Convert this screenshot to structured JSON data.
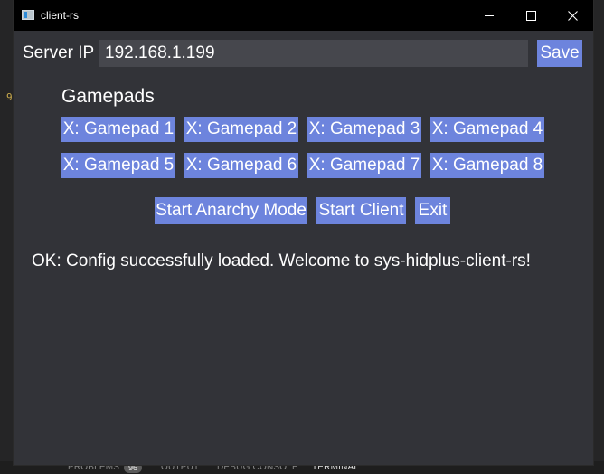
{
  "window": {
    "title": "client-rs"
  },
  "server": {
    "label": "Server IP",
    "ip_value": "192.168.1.199",
    "save_label": "Save"
  },
  "gamepads": {
    "heading": "Gamepads",
    "buttons": [
      "X: Gamepad 1",
      "X: Gamepad 2",
      "X: Gamepad 3",
      "X: Gamepad 4",
      "X: Gamepad 5",
      "X: Gamepad 6",
      "X: Gamepad 7",
      "X: Gamepad 8"
    ]
  },
  "actions": {
    "anarchy_label": "Start Anarchy Mode",
    "start_client_label": "Start Client",
    "exit_label": "Exit"
  },
  "status": {
    "message": "OK: Config successfully loaded. Welcome to sys-hidplus-client-rs!"
  },
  "background_editor": {
    "gutter_number": "9",
    "panel_tabs": {
      "problems": "PROBLEMS",
      "problems_count": "96",
      "output": "OUTPUT",
      "debug_console": "DEBUG CONSOLE",
      "terminal": "TERMINAL"
    }
  },
  "colors": {
    "window_bg": "#323338",
    "titlebar_bg": "#000000",
    "button_bg": "#6d84dd",
    "input_bg": "#46474d",
    "text": "#ffffff"
  }
}
